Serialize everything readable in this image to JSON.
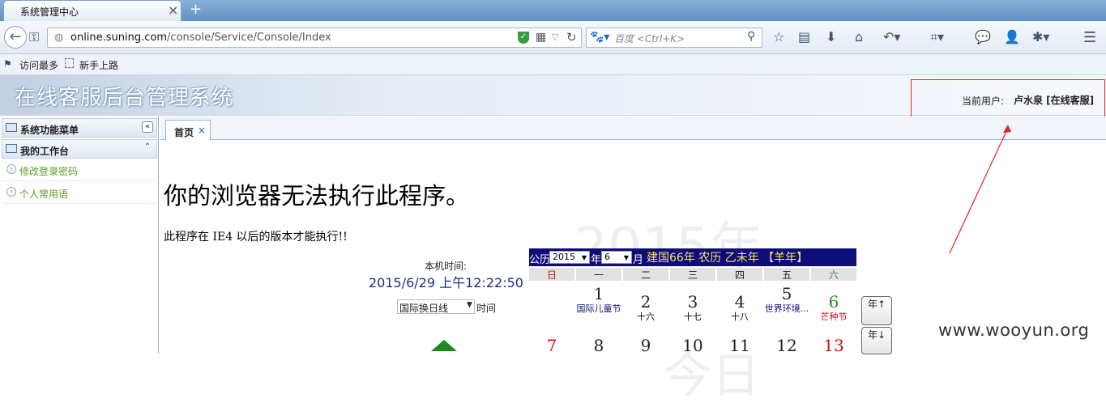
{
  "browser": {
    "tab_title": "系统管理中心",
    "tab_close": "×",
    "new_tab": "+",
    "url_domain": "online.suning.com",
    "url_path": "/console/Service/Console/Index",
    "search_placeholder": "百度 <Ctrl+K>",
    "bookmarks": [
      "访问最多",
      "新手上路"
    ]
  },
  "header": {
    "title": "在线客服后台管理系统",
    "user_label": "当前用户:",
    "user_value": "卢水泉 [在线客服]"
  },
  "sidebar": {
    "panels": [
      {
        "label": "系统功能菜单",
        "toggle": "«"
      },
      {
        "label": "我的工作台",
        "toggle": "⌃"
      }
    ],
    "items": [
      {
        "label": "修改登录密码"
      },
      {
        "label": "个人常用语"
      }
    ]
  },
  "main": {
    "tab_label": "首页",
    "tab_close": "×",
    "error_title": "你的浏览器无法执行此程序。",
    "error_detail": "此程序在 IE4 以后的版本才能执行!!",
    "watermark_year": "2015年",
    "watermark_day": "今日"
  },
  "clock": {
    "label": "本机时间:",
    "value": "2015/6/29 上午12:22:50",
    "timezone_selected": "国际换日线",
    "timezone_suffix": "时间"
  },
  "calendar": {
    "head_left": "公历",
    "year_value": "2015",
    "year_suffix": "年",
    "month_value": "6",
    "month_suffix": "月",
    "info": "建国66年 农历 乙未年 【羊年】",
    "weekdays": [
      "日",
      "一",
      "二",
      "三",
      "四",
      "五",
      "六"
    ],
    "row1": [
      {
        "n": "",
        "s": ""
      },
      {
        "n": "1",
        "s": "国际儿童节"
      },
      {
        "n": "2",
        "s": "十六"
      },
      {
        "n": "3",
        "s": "十七"
      },
      {
        "n": "4",
        "s": "十八"
      },
      {
        "n": "5",
        "s": "世界环境..."
      },
      {
        "n": "6",
        "s": "芒种节"
      }
    ],
    "row2": [
      "7",
      "8",
      "9",
      "10",
      "11",
      "12",
      "13"
    ],
    "year_up": "年↑",
    "year_down": "年↓"
  },
  "watermark": "www.wooyun.org",
  "colors": {
    "calendar_header": "#0d0d7a",
    "sunday": "#cc1111",
    "saturday": "#2e8b2e",
    "annotation": "#d9262b"
  }
}
